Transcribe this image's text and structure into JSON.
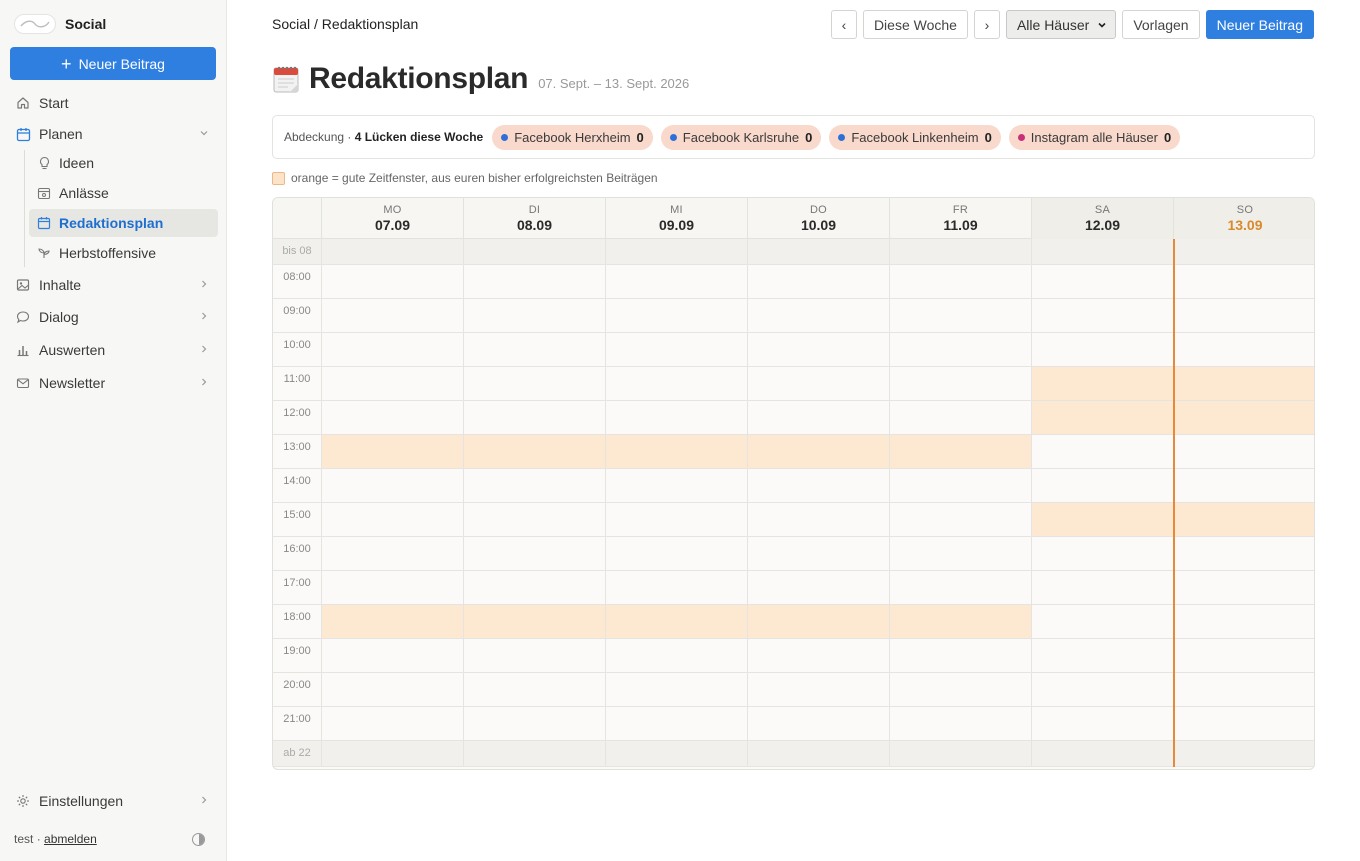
{
  "app": {
    "name": "Social"
  },
  "sidebar": {
    "new_button": "Neuer Beitrag",
    "items": [
      {
        "label": "Start",
        "icon": "home-icon"
      },
      {
        "label": "Planen",
        "icon": "calendar-icon",
        "expanded": true
      },
      {
        "label": "Inhalte",
        "icon": "image-icon"
      },
      {
        "label": "Dialog",
        "icon": "chat-icon"
      },
      {
        "label": "Auswerten",
        "icon": "bar-chart-icon"
      },
      {
        "label": "Newsletter",
        "icon": "mail-icon"
      }
    ],
    "sub_items": [
      {
        "label": "Ideen",
        "icon": "lightbulb-icon"
      },
      {
        "label": "Anlässe",
        "icon": "calendar-event-icon"
      },
      {
        "label": "Redaktionsplan",
        "icon": "calendar-icon",
        "active": true
      },
      {
        "label": "Herbstoffensive",
        "icon": "sprout-icon"
      }
    ],
    "settings": "Einstellungen",
    "user": "test",
    "separator": "·",
    "logout": "abmelden"
  },
  "header": {
    "breadcrumb": "Social / Redaktionsplan",
    "prev": "‹",
    "this_week": "Diese Woche",
    "next": "›",
    "house_select": "Alle Häuser",
    "templates": "Vorlagen",
    "new_post": "Neuer Beitrag"
  },
  "page": {
    "title": "Redaktionsplan",
    "date_range": "07. Sept. – 13. Sept. 2026"
  },
  "coverage": {
    "label": "Abdeckung",
    "sep": " · ",
    "gaps": "4 Lücken diese Woche",
    "chips": [
      {
        "label": "Facebook Herxheim",
        "count": "0",
        "color": "#2f6fd8"
      },
      {
        "label": "Facebook Karlsruhe",
        "count": "0",
        "color": "#2f6fd8"
      },
      {
        "label": "Facebook Linkenheim",
        "count": "0",
        "color": "#2f6fd8"
      },
      {
        "label": "Instagram alle Häuser",
        "count": "0",
        "color": "#c8307a"
      }
    ]
  },
  "legend": {
    "text": "orange = gute Zeitfenster, aus euren bisher erfolgreichsten Beiträgen"
  },
  "calendar": {
    "days": [
      {
        "dow": "MO",
        "date": "07.09",
        "weekend": false,
        "today": false
      },
      {
        "dow": "DI",
        "date": "08.09",
        "weekend": false,
        "today": false
      },
      {
        "dow": "MI",
        "date": "09.09",
        "weekend": false,
        "today": false
      },
      {
        "dow": "DO",
        "date": "10.09",
        "weekend": false,
        "today": false
      },
      {
        "dow": "FR",
        "date": "11.09",
        "weekend": false,
        "today": false
      },
      {
        "dow": "SA",
        "date": "12.09",
        "weekend": true,
        "today": false
      },
      {
        "dow": "SO",
        "date": "13.09",
        "weekend": true,
        "today": true
      }
    ],
    "slots": [
      {
        "label": "bis 08",
        "edge": true,
        "good": []
      },
      {
        "label": "08:00",
        "good": []
      },
      {
        "label": "09:00",
        "good": []
      },
      {
        "label": "10:00",
        "good": []
      },
      {
        "label": "11:00",
        "good": [
          5,
          6
        ]
      },
      {
        "label": "12:00",
        "good": [
          5,
          6
        ]
      },
      {
        "label": "13:00",
        "good": [
          0,
          1,
          2,
          3,
          4
        ]
      },
      {
        "label": "14:00",
        "good": []
      },
      {
        "label": "15:00",
        "good": [
          5,
          6
        ]
      },
      {
        "label": "16:00",
        "good": []
      },
      {
        "label": "17:00",
        "good": []
      },
      {
        "label": "18:00",
        "good": [
          0,
          1,
          2,
          3,
          4
        ]
      },
      {
        "label": "19:00",
        "good": []
      },
      {
        "label": "20:00",
        "good": []
      },
      {
        "label": "21:00",
        "good": []
      },
      {
        "label": "ab 22",
        "edge": true,
        "good": []
      }
    ]
  }
}
